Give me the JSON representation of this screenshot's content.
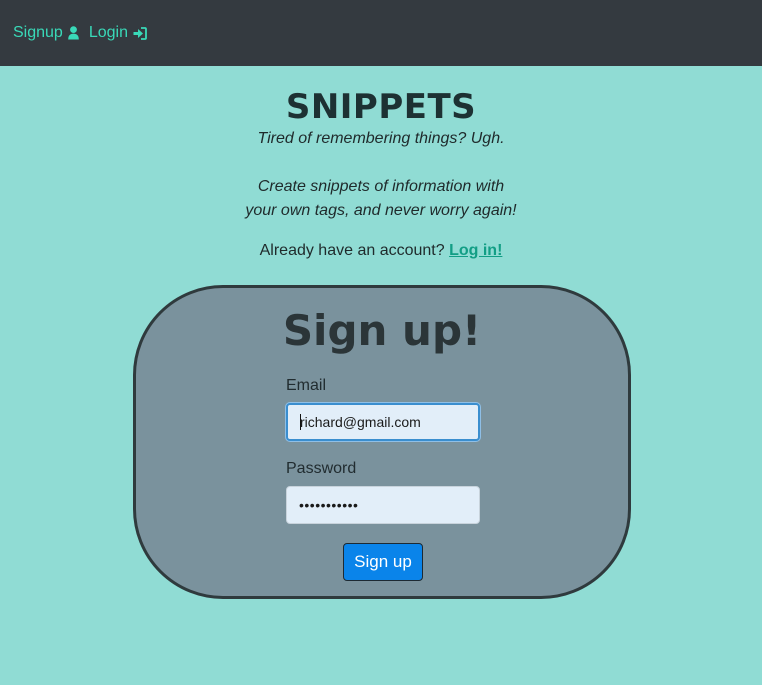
{
  "nav": {
    "signup_label": "Signup",
    "login_label": "Login",
    "signup_icon": "user-icon",
    "login_icon": "sign-in-icon"
  },
  "hero": {
    "title": "SNIPPETS",
    "tagline": "Tired of remembering things? Ugh.",
    "description_line1": "Create snippets of information with",
    "description_line2": "your own tags, and never worry again!",
    "account_prompt": "Already have an account?",
    "login_link": "Log in!"
  },
  "form": {
    "title": "Sign up!",
    "email_label": "Email",
    "email_value": "richard@gmail.com",
    "password_label": "Password",
    "password_value": "•••••••••••",
    "submit_label": "Sign up"
  },
  "colors": {
    "background": "#90dcd4",
    "navbar": "#343a40",
    "nav_link": "#39d9b8",
    "card": "#7a929d",
    "button": "#0a84ea"
  }
}
